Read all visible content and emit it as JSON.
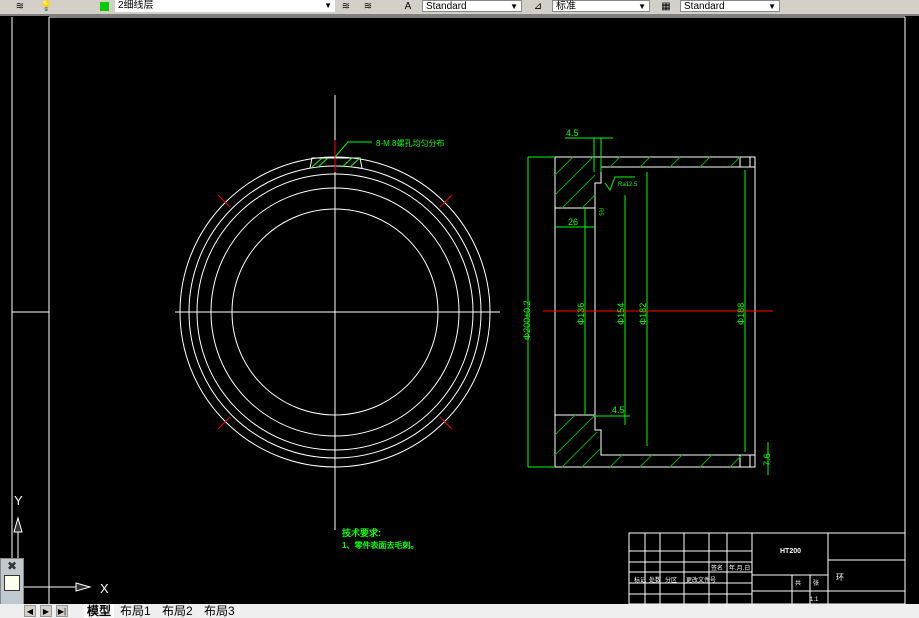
{
  "toolbar": {
    "layer": "2细线层",
    "text_style": "Standard",
    "dim_style": "标准",
    "table_style": "Standard"
  },
  "drawing": {
    "hole_note": "8-M  8螺孔均匀分布",
    "dims": {
      "top_step": "4.5",
      "bottom_step": "4.5",
      "width26": "26",
      "roughness": "Ra12.5",
      "chamfer": "R5",
      "d200": "Φ200±0.2",
      "d136": "Φ136",
      "d154": "Φ154",
      "d182": "Φ182",
      "d188": "Φ188",
      "d76": "7.6"
    },
    "tech_title": "技术要求:",
    "tech_item1": "1、零件表面去毛刺。"
  },
  "title_block": {
    "part_code": "HT200",
    "name": "环",
    "scale": "1:1",
    "sheet_mark": "共",
    "sheet_mark2": "张",
    "label_a": "标记",
    "label_b": "处数",
    "label_c": "分区",
    "label_d": "更改文件号",
    "label_e": "签名",
    "label_f": "年.月.日"
  },
  "ucs": {
    "x": "X",
    "y": "Y"
  },
  "tabs": [
    "模型",
    "布局1",
    "布局2",
    "布局3"
  ],
  "colors": {
    "line": "#ffffff",
    "dim": "#00ff00",
    "center": "#ff0000",
    "bg": "#000000"
  }
}
